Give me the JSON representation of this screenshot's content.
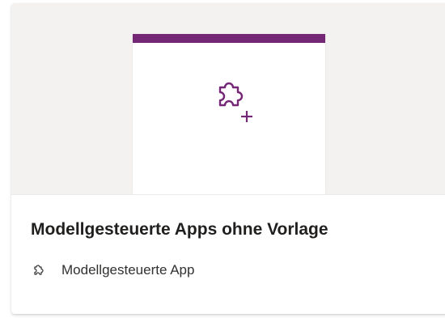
{
  "card": {
    "title": "Modellgesteuerte Apps ohne Vorlage",
    "type_label": "Modellgesteuerte App",
    "preview_icon": "puzzle-plus-icon",
    "type_icon": "puzzle-icon"
  },
  "colors": {
    "accent": "#742774",
    "preview_bg": "#f3f2f1",
    "title_text": "#201f1e",
    "meta_text": "#323130"
  }
}
